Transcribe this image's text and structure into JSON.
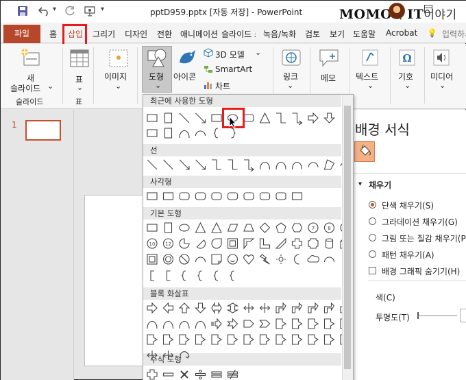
{
  "title_bar": {
    "filename": "pptD959.pptx",
    "autosave": "[자동 저장]",
    "separator": "-",
    "app_name": "PowerPoint",
    "watermark_left": "MOMO",
    "watermark_mid": "의 ",
    "watermark_bold": "IT",
    "watermark_right": "이야기"
  },
  "tabs": [
    {
      "label": "파일"
    },
    {
      "label": "홈"
    },
    {
      "label": "삽입"
    },
    {
      "label": "그리기"
    },
    {
      "label": "디자인"
    },
    {
      "label": "전환"
    },
    {
      "label": "애니메이션"
    },
    {
      "label": "슬라이드 쇼"
    },
    {
      "label": "녹음/녹화"
    },
    {
      "label": "검토"
    },
    {
      "label": "보기"
    },
    {
      "label": "도움말"
    },
    {
      "label": "Acrobat"
    },
    {
      "label": "입력하세요"
    }
  ],
  "active_tab": "삽입",
  "ribbon": {
    "new_slide_line1": "새",
    "new_slide_line2": "슬라이드",
    "chevron": "⌄",
    "group_slides": "슬라이드",
    "table": "표",
    "group_table": "표",
    "images": "이미지",
    "shapes": "도형",
    "icons": "아이콘",
    "model_3d": "3D 모델",
    "smartart": "SmartArt",
    "chart": "차트",
    "link": "링크",
    "comment": "메모",
    "text": "텍스트",
    "symbol": "기호",
    "media": "미디어"
  },
  "slide_pane": {
    "slide_number": "1"
  },
  "format_pane": {
    "title": "배경 서식",
    "fill_section": "채우기",
    "options": [
      {
        "label": "단색 채우기(S)",
        "selected": true
      },
      {
        "label": "그라데이션 채우기(G)",
        "selected": false
      },
      {
        "label": "그림 또는 질감 채우기(P)",
        "selected": false
      },
      {
        "label": "패턴 채우기(A)",
        "selected": false
      }
    ],
    "hide_graphics": "배경 그래픽 숨기기(H)",
    "color_label": "색(C)",
    "transparency_label": "투명도(T)"
  },
  "shapes_gallery": {
    "sections": [
      "최근에 사용한 도형",
      "선",
      "사각형",
      "기본 도형",
      "블록 화살표",
      "수식 도형"
    ],
    "selected_shape": "oval-shape"
  },
  "colors": {
    "accent": "#b7472a",
    "highlight": "#e41c1c",
    "shape_icon": "#444444"
  }
}
